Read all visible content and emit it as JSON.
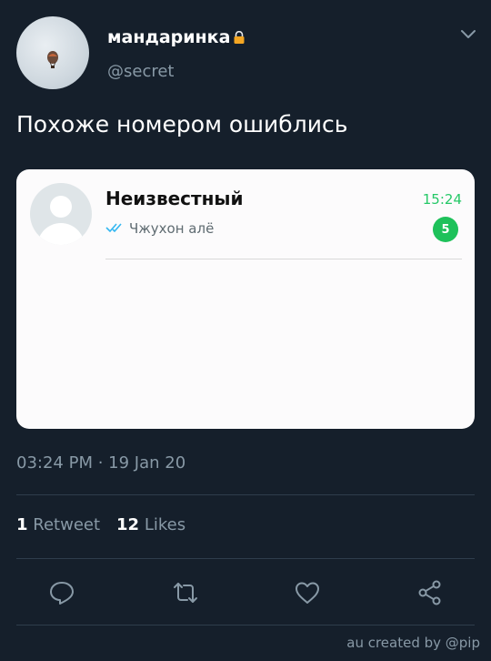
{
  "user": {
    "display_name": "мандаринка",
    "handle": "@secret"
  },
  "tweet": {
    "text": "Похоже номером ошиблись",
    "timestamp": "03:24 PM · 19 Jan 20"
  },
  "chat_card": {
    "contact_name": "Неизвестный",
    "time": "15:24",
    "preview": "Чжухон алё",
    "unread_count": "5"
  },
  "stats": {
    "retweets_count": "1",
    "retweets_label": "Retweet",
    "likes_count": "12",
    "likes_label": "Likes"
  },
  "credit": "au created by @pip",
  "colors": {
    "background": "#151f2b",
    "secondary_text": "#8899a6",
    "whatsapp_green": "#25c867",
    "check_blue": "#34b7f1"
  },
  "icons": [
    "lock-icon",
    "chevron-down-icon",
    "double-check-icon",
    "reply-icon",
    "retweet-icon",
    "like-icon",
    "share-icon"
  ]
}
